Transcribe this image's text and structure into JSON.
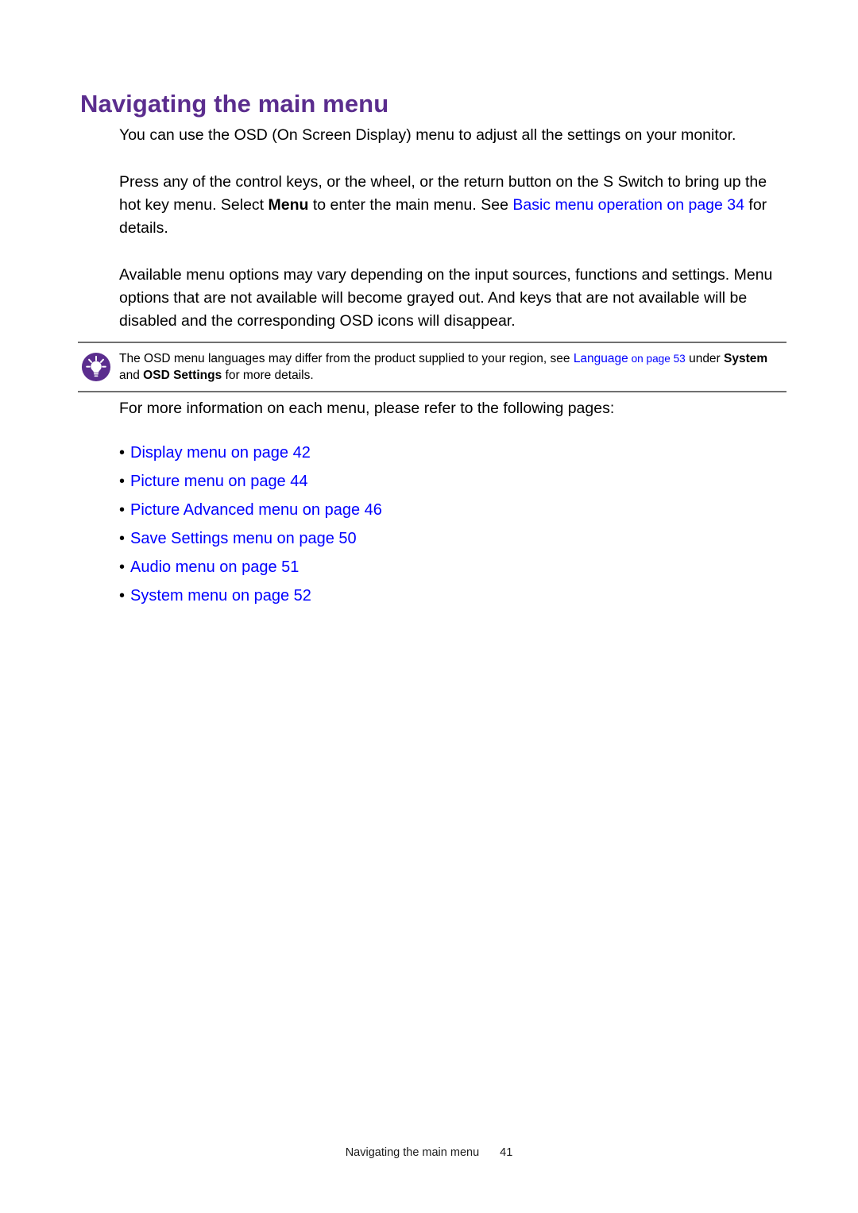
{
  "document": {
    "heading": "Navigating the main menu",
    "paragraphs": {
      "p1": "You can use the OSD (On Screen Display) menu to adjust all the settings on your monitor.",
      "p2_part1": "Press any of the control keys, or the wheel, or the return button on the S Switch to bring up the hot key menu. Select ",
      "p2_bold": "Menu",
      "p2_part2": " to enter the main menu. See ",
      "p2_link": "Basic menu operation on page 34",
      "p2_part3": " for details.",
      "p3": "Available menu options may vary depending on the input sources, functions and settings. Menu options that are not available will become grayed out. And keys that are not available will be disabled and the corresponding OSD icons will disappear."
    },
    "note": {
      "icon": "lightbulb-tip-icon",
      "icon_color": "#5b2d8e",
      "text_part1": "The OSD menu languages may differ from the product supplied to your region, see ",
      "link_label": "Language",
      "link_page": " on page 53",
      "text_part2": " under ",
      "bold1": "System",
      "text_part3": " and ",
      "bold2": "OSD Settings",
      "text_part4": " for more details."
    },
    "lead_in": "For more information on each menu, please refer to the following pages:",
    "bullet_marker": "•",
    "links": [
      {
        "label": "Display menu on page 42"
      },
      {
        "label": "Picture menu on page 44"
      },
      {
        "label": "Picture Advanced menu on page 46"
      },
      {
        "label": "Save Settings menu on page 50"
      },
      {
        "label": "Audio menu on page 51"
      },
      {
        "label": "System menu on page 52"
      }
    ],
    "footer": {
      "title": "Navigating the main menu",
      "page_number": "41"
    },
    "colors": {
      "heading_purple": "#5b2d8e",
      "link_blue": "#0000ff",
      "rule_gray": "#707070",
      "body_black": "#000000"
    }
  }
}
